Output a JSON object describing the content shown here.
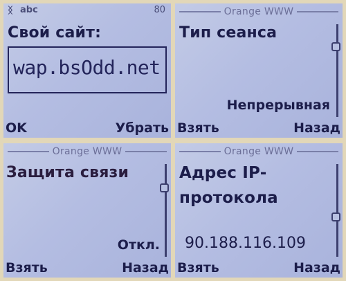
{
  "screen1": {
    "status_signal": "ᛝ",
    "status_mode": "abc",
    "status_count": "80",
    "title": "Свой сайт:",
    "input_value": "wap.bsOdd.net",
    "left_soft": "OK",
    "right_soft": "Убрать"
  },
  "screen2": {
    "header": "Orange WWW",
    "title": "Тип сеанса",
    "value": "Непрерывная",
    "left_soft": "Взять",
    "right_soft": "Назад"
  },
  "screen3": {
    "header": "Orange WWW",
    "title": "Защита связи",
    "value": "Откл.",
    "left_soft": "Взять",
    "right_soft": "Назад"
  },
  "screen4": {
    "header": "Orange WWW",
    "title_line1": "Адрес IP-",
    "title_line2": "протокола",
    "value": "90.188.116.109",
    "left_soft": "Взять",
    "right_soft": "Назад"
  },
  "colors": {
    "screen_bg": "#b4bde2",
    "text": "#1c1d4a",
    "header_text": "#6c6f98",
    "frame": "#e2d7b8"
  }
}
